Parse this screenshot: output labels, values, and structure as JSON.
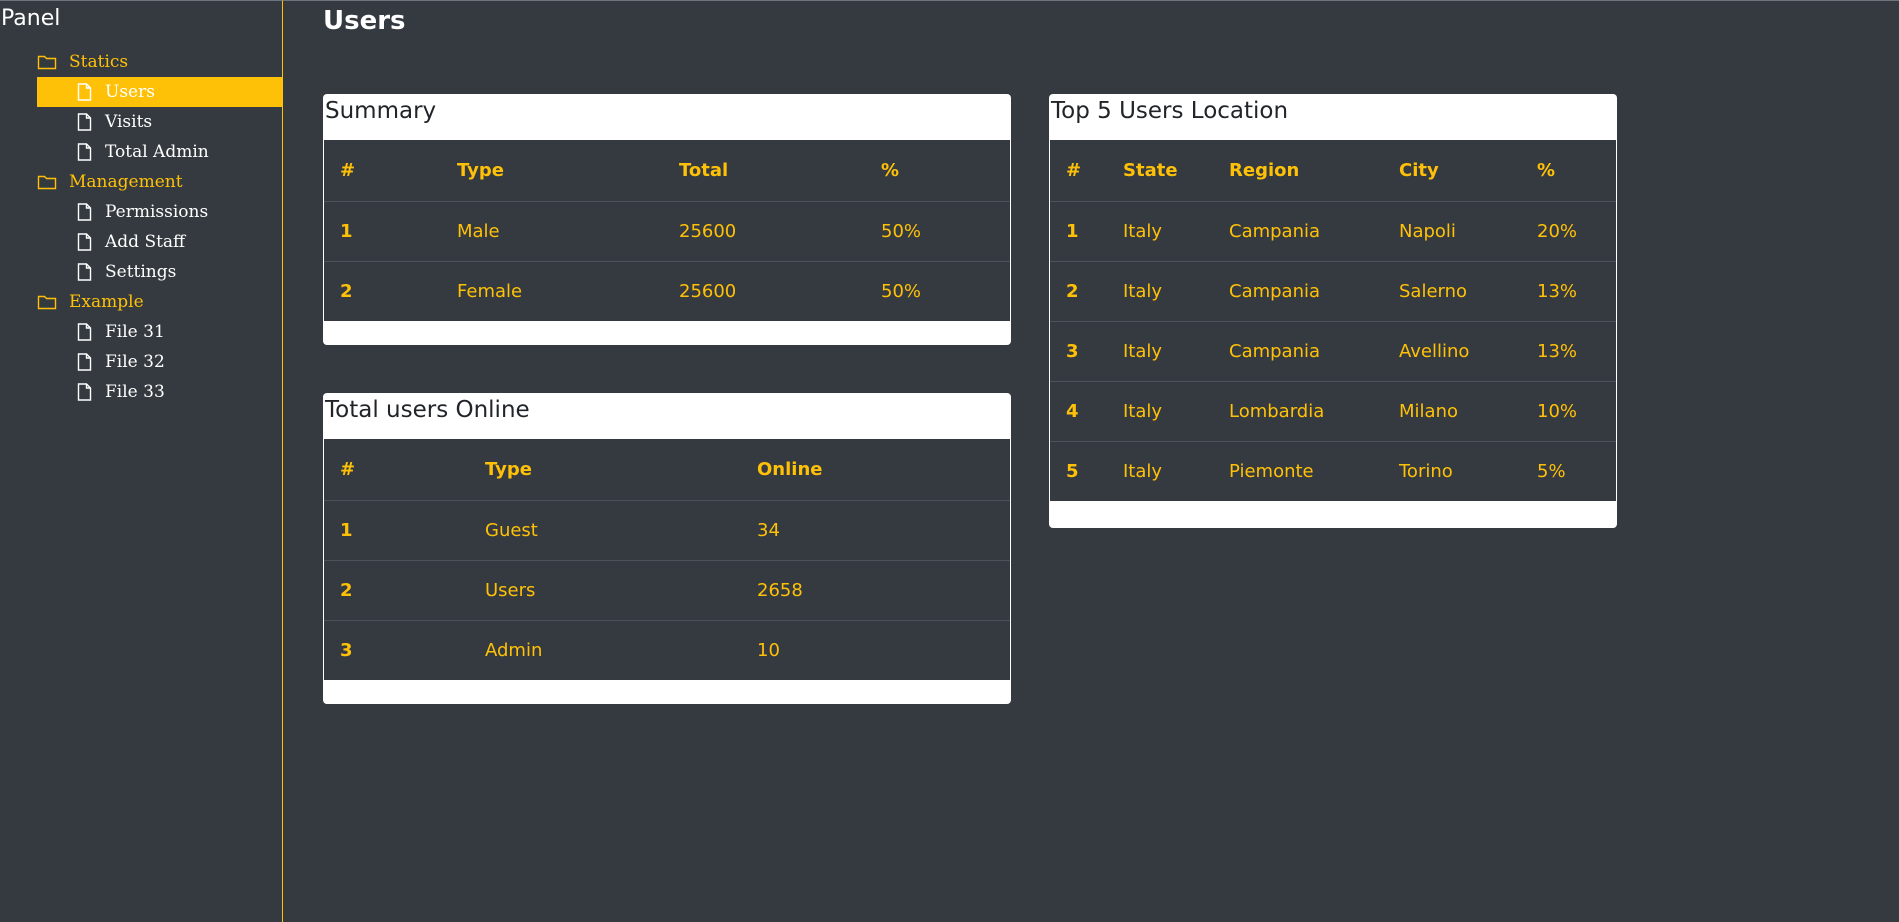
{
  "sidebar": {
    "title": "Panel",
    "items": [
      {
        "type": "folder",
        "label": "Statics"
      },
      {
        "type": "file",
        "label": "Users",
        "active": true
      },
      {
        "type": "file",
        "label": "Visits"
      },
      {
        "type": "file",
        "label": "Total Admin"
      },
      {
        "type": "folder",
        "label": "Management"
      },
      {
        "type": "file",
        "label": "Permissions"
      },
      {
        "type": "file",
        "label": "Add Staff"
      },
      {
        "type": "file",
        "label": "Settings"
      },
      {
        "type": "folder",
        "label": "Example"
      },
      {
        "type": "file",
        "label": "File 31"
      },
      {
        "type": "file",
        "label": "File 32"
      },
      {
        "type": "file",
        "label": "File 33"
      }
    ]
  },
  "page": {
    "title": "Users"
  },
  "summary": {
    "title": "Summary",
    "headers": [
      "#",
      "Type",
      "Total",
      "%"
    ],
    "rows": [
      [
        "1",
        "Male",
        "25600",
        "50%"
      ],
      [
        "2",
        "Female",
        "25600",
        "50%"
      ]
    ]
  },
  "online": {
    "title": "Total users Online",
    "headers": [
      "#",
      "Type",
      "Online"
    ],
    "rows": [
      [
        "1",
        "Guest",
        "34"
      ],
      [
        "2",
        "Users",
        "2658"
      ],
      [
        "3",
        "Admin",
        "10"
      ]
    ]
  },
  "location": {
    "title": "Top 5 Users Location",
    "headers": [
      "#",
      "State",
      "Region",
      "City",
      "%"
    ],
    "rows": [
      [
        "1",
        "Italy",
        "Campania",
        "Napoli",
        "20%"
      ],
      [
        "2",
        "Italy",
        "Campania",
        "Salerno",
        "13%"
      ],
      [
        "3",
        "Italy",
        "Campania",
        "Avellino",
        "13%"
      ],
      [
        "4",
        "Italy",
        "Lombardia",
        "Milano",
        "10%"
      ],
      [
        "5",
        "Italy",
        "Piemonte",
        "Torino",
        "5%"
      ]
    ]
  },
  "colors": {
    "accent": "#ffc107",
    "background": "#343a40",
    "card": "#ffffff"
  },
  "icons": {
    "folder": "folder-icon",
    "file": "file-icon"
  }
}
